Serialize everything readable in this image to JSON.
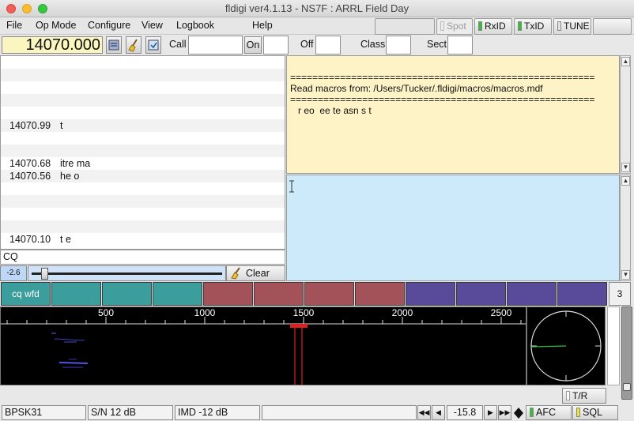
{
  "window": {
    "title": "fldigi ver4.1.13 - NS7F :  ARRL Field Day"
  },
  "menu": {
    "items": [
      "File",
      "Op Mode",
      "Configure",
      "View",
      "Logbook",
      "Help"
    ]
  },
  "toolbar": {
    "spot": "Spot",
    "rxid": "RxID",
    "txid": "TxID",
    "tune": "TUNE"
  },
  "qso": {
    "frequency": "14070.000",
    "call_label": "Call",
    "on_label": "On",
    "off_label": "Off",
    "class_label": "Class",
    "sect_label": "Sect",
    "call": "",
    "on": "",
    "off": "",
    "class": "",
    "sect": ""
  },
  "rx_list": [
    {
      "freq": "",
      "text": ""
    },
    {
      "freq": "",
      "text": ""
    },
    {
      "freq": "",
      "text": ""
    },
    {
      "freq": "",
      "text": ""
    },
    {
      "freq": "",
      "text": ""
    },
    {
      "freq": "14070.99",
      "text": "t"
    },
    {
      "freq": "",
      "text": ""
    },
    {
      "freq": "",
      "text": ""
    },
    {
      "freq": "14070.68",
      "text": "itre ma"
    },
    {
      "freq": "14070.56",
      "text": "he o"
    },
    {
      "freq": "",
      "text": ""
    },
    {
      "freq": "",
      "text": ""
    },
    {
      "freq": "",
      "text": ""
    },
    {
      "freq": "",
      "text": ""
    },
    {
      "freq": "14070.10",
      "text": "t e"
    }
  ],
  "macro_pane": {
    "lines": [
      "=======================================================",
      "Read macros from: /Users/Tucker/.fldigi/macros/macros.mdf",
      "=======================================================",
      "   r eo  ee te asn s t"
    ]
  },
  "cq_line": "CQ",
  "squelch": {
    "value": "-2.6",
    "level": 0.06
  },
  "clear_label": "Clear",
  "macros": {
    "buttons": [
      "cq wfd",
      "",
      "",
      "",
      "",
      "",
      "",
      "",
      "",
      "",
      "",
      ""
    ],
    "page": "3",
    "colors": {
      "teal": "#3b9d9c",
      "red": "#a4525a",
      "purple": "#5a4a9a"
    }
  },
  "waterfall": {
    "scale": [
      "500",
      "1000",
      "1500",
      "2000",
      "2500"
    ]
  },
  "tr_label": "T/R",
  "status": {
    "mode": "BPSK31",
    "sn": "S/N 12 dB",
    "imd": "IMD -12 dB",
    "message": "",
    "offset": "-15.8",
    "afc": "AFC",
    "sql": "SQL"
  }
}
